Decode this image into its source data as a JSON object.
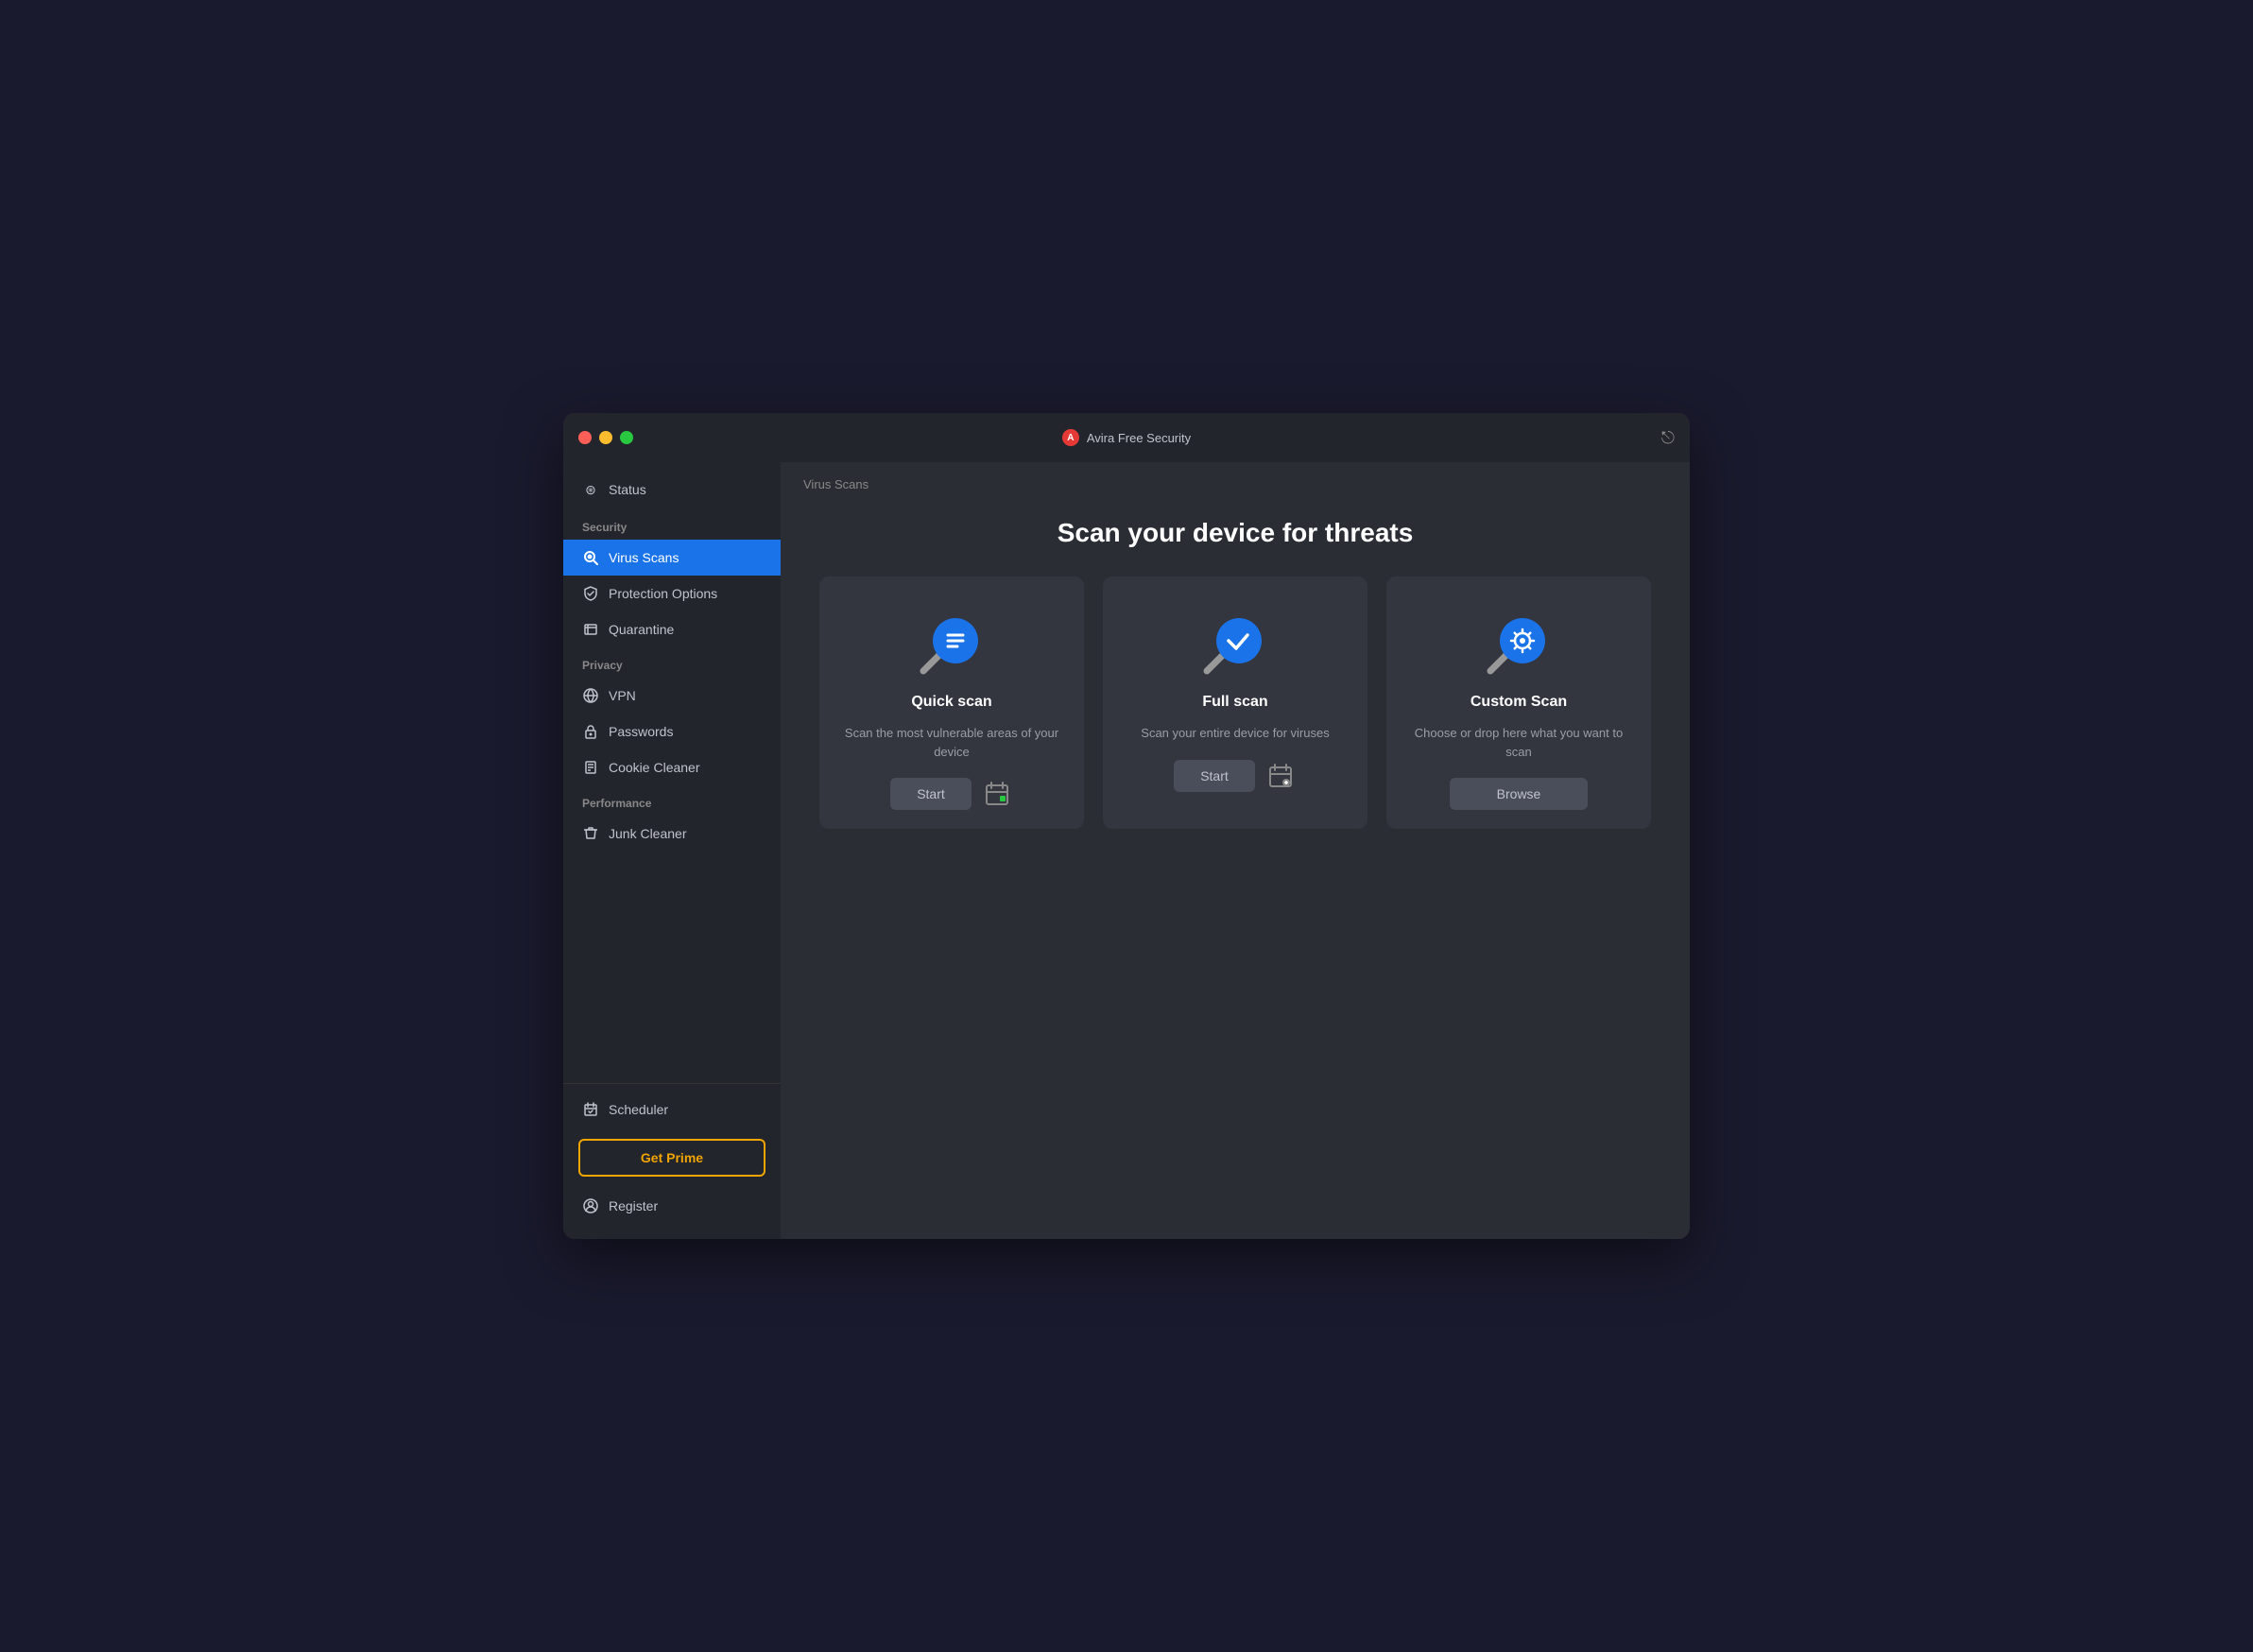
{
  "window": {
    "title": "Avira Free Security"
  },
  "titlebar": {
    "title": "Avira Free Security",
    "close_label": "close",
    "minimize_label": "minimize",
    "maximize_label": "maximize"
  },
  "sidebar": {
    "status_label": "Status",
    "section_security": "Security",
    "section_privacy": "Privacy",
    "section_performance": "Performance",
    "items": [
      {
        "id": "virus-scans",
        "label": "Virus Scans",
        "active": true
      },
      {
        "id": "protection-options",
        "label": "Protection Options",
        "active": false
      },
      {
        "id": "quarantine",
        "label": "Quarantine",
        "active": false
      },
      {
        "id": "vpn",
        "label": "VPN",
        "active": false
      },
      {
        "id": "passwords",
        "label": "Passwords",
        "active": false
      },
      {
        "id": "cookie-cleaner",
        "label": "Cookie Cleaner",
        "active": false
      },
      {
        "id": "junk-cleaner",
        "label": "Junk Cleaner",
        "active": false
      }
    ],
    "scheduler_label": "Scheduler",
    "get_prime_label": "Get Prime",
    "register_label": "Register"
  },
  "main": {
    "breadcrumb": "Virus Scans",
    "page_title": "Scan your device for threats",
    "cards": [
      {
        "id": "quick-scan",
        "title": "Quick scan",
        "description": "Scan the most vulnerable areas of your device",
        "primary_action": "Start",
        "has_schedule": true
      },
      {
        "id": "full-scan",
        "title": "Full scan",
        "description": "Scan your entire device for viruses",
        "primary_action": "Start",
        "has_schedule": true
      },
      {
        "id": "custom-scan",
        "title": "Custom Scan",
        "description": "Choose or drop here what you want to scan",
        "primary_action": "Browse",
        "has_schedule": false
      }
    ]
  },
  "colors": {
    "active_blue": "#1a73e8",
    "accent_orange": "#f0a500",
    "icon_blue": "#1a73e8",
    "bg_dark": "#23252d",
    "bg_main": "#2b2d35",
    "bg_card": "#33353f",
    "text_primary": "#ffffff",
    "text_secondary": "#9a9ca8",
    "text_muted": "#888888"
  }
}
